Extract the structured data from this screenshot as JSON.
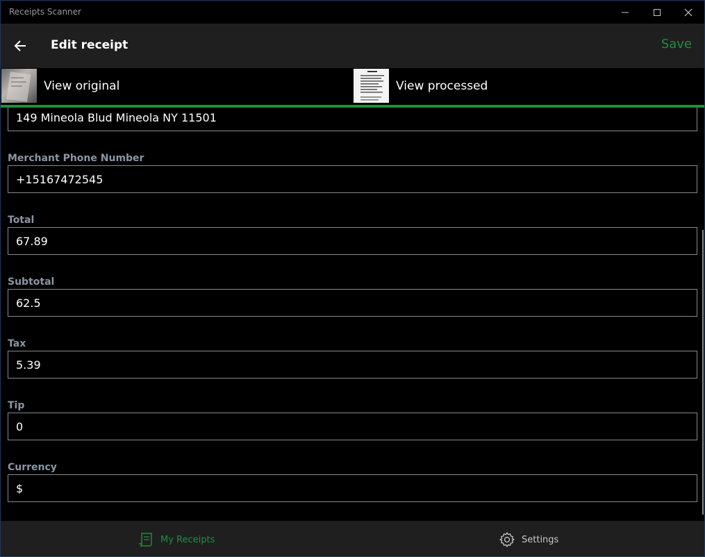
{
  "window": {
    "title": "Receipts Scanner"
  },
  "header": {
    "title": "Edit receipt",
    "save_label": "Save"
  },
  "tabs": [
    {
      "label": "View original"
    },
    {
      "label": "View processed"
    }
  ],
  "fields": {
    "address": {
      "value": "149 Mineola Blud Mineola NY 11501"
    },
    "phone": {
      "label": "Merchant Phone Number",
      "value": "+15167472545"
    },
    "total": {
      "label": "Total",
      "value": "67.89"
    },
    "subtotal": {
      "label": "Subtotal",
      "value": "62.5"
    },
    "tax": {
      "label": "Tax",
      "value": "5.39"
    },
    "tip": {
      "label": "Tip",
      "value": "0"
    },
    "currency": {
      "label": "Currency",
      "value": "$"
    }
  },
  "nav": {
    "receipts": {
      "label": "My Receipts",
      "icon": "receipt-icon"
    },
    "settings": {
      "label": "Settings",
      "icon": "gear-icon"
    }
  },
  "colors": {
    "accent": "#1e8f3c",
    "label": "#8a96a3",
    "header_bg": "#1f1f1f"
  }
}
